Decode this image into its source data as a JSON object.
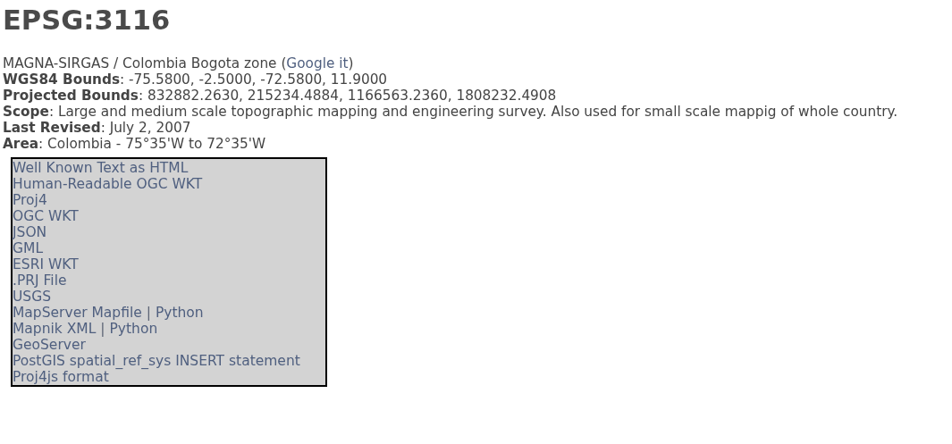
{
  "title": "EPSG:3116",
  "name": {
    "text": "MAGNA-SIRGAS / Colombia Bogota zone",
    "open": "(",
    "link": "Google it",
    "close": ")"
  },
  "properties": [
    "**WGS84 Bounds**: -75.5800, -2.5000, -72.5800, 11.9000",
    "**Projected Bounds**: 832882.2630, 215234.4884, 1166563.2360, 1808232.4908",
    "**Scope**: Large and medium scale topographic mapping and engineering survey. Also used for small scale mappig of whole country.",
    "**Last Revised**: July 2, 2007",
    "**Area**: Colombia - 75°35'W to 72°35'W"
  ],
  "formats": [
    [
      {
        "kind": "link",
        "text": "Well Known Text as HTML"
      }
    ],
    [
      {
        "kind": "link",
        "text": "Human-Readable OGC WKT"
      }
    ],
    [
      {
        "kind": "link",
        "text": "Proj4"
      }
    ],
    [
      {
        "kind": "link",
        "text": "OGC WKT"
      }
    ],
    [
      {
        "kind": "link",
        "text": "JSON"
      }
    ],
    [
      {
        "kind": "link",
        "text": "GML"
      }
    ],
    [
      {
        "kind": "link",
        "text": "ESRI WKT"
      }
    ],
    [
      {
        "kind": "link",
        "text": ".PRJ File"
      }
    ],
    [
      {
        "kind": "link",
        "text": "USGS"
      }
    ],
    [
      {
        "kind": "link",
        "text": "MapServer Mapfile"
      },
      {
        "kind": "separator",
        "text": "|"
      },
      {
        "kind": "link",
        "text": "Python"
      }
    ],
    [
      {
        "kind": "link",
        "text": "Mapnik XML"
      },
      {
        "kind": "separator",
        "text": "|"
      },
      {
        "kind": "link",
        "text": "Python"
      }
    ],
    [
      {
        "kind": "link",
        "text": "GeoServer"
      }
    ],
    [
      {
        "kind": "link",
        "text": "PostGIS spatial_ref_sys INSERT statement"
      }
    ],
    [
      {
        "kind": "link",
        "text": "Proj4js format"
      }
    ]
  ]
}
